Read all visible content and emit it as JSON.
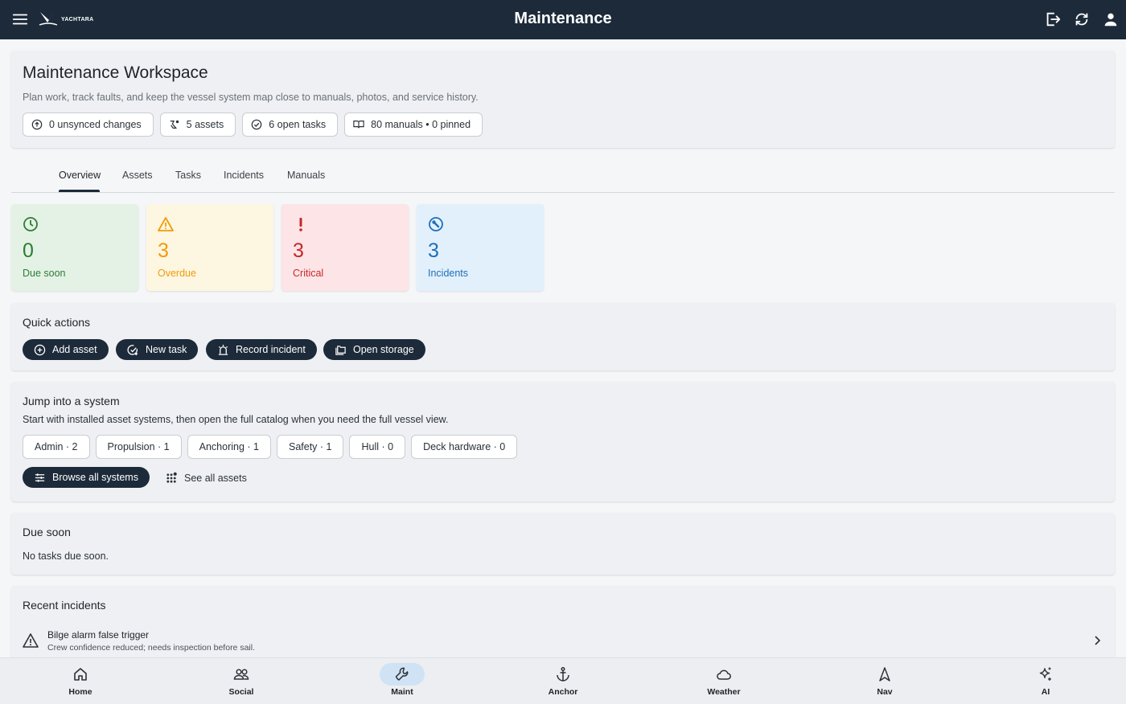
{
  "appbar": {
    "title": "Maintenance",
    "logo_text": "YACHTARA"
  },
  "header": {
    "title": "Maintenance Workspace",
    "subtitle": "Plan work, track faults, and keep the vessel system map close to manuals, photos, and service history.",
    "chips": [
      {
        "icon": "sync-upload-icon",
        "label": "0 unsynced changes"
      },
      {
        "icon": "assets-icon",
        "label": "5 assets"
      },
      {
        "icon": "check-circle-icon",
        "label": "6 open tasks"
      },
      {
        "icon": "book-icon",
        "label": "80 manuals • 0 pinned"
      }
    ]
  },
  "tabs": {
    "items": [
      "Overview",
      "Assets",
      "Tasks",
      "Incidents",
      "Manuals"
    ],
    "active": "Overview"
  },
  "stats": [
    {
      "icon": "clock-icon",
      "value": "0",
      "label": "Due soon",
      "color": "#2e7d32",
      "bg": "#e4f2e6"
    },
    {
      "icon": "warning-icon",
      "value": "3",
      "label": "Overdue",
      "color": "#f29b0a",
      "bg": "#fdf6e1"
    },
    {
      "icon": "exclamation-icon",
      "value": "3",
      "label": "Critical",
      "color": "#c62828",
      "bg": "#fde4e7"
    },
    {
      "icon": "wrench-circle-icon",
      "value": "3",
      "label": "Incidents",
      "color": "#1e6fb8",
      "bg": "#e2f0fb"
    }
  ],
  "quick_actions": {
    "title": "Quick actions",
    "buttons": [
      {
        "icon": "plus-circle-icon",
        "label": "Add asset"
      },
      {
        "icon": "task-add-icon",
        "label": "New task"
      },
      {
        "icon": "alarm-light-icon",
        "label": "Record incident"
      },
      {
        "icon": "folder-copy-icon",
        "label": "Open storage"
      }
    ]
  },
  "systems": {
    "title": "Jump into a system",
    "subtitle": "Start with installed asset systems, then open the full catalog when you need the full vessel view.",
    "chips": [
      "Admin · 2",
      "Propulsion · 1",
      "Anchoring · 1",
      "Safety · 1",
      "Hull · 0",
      "Deck hardware · 0"
    ],
    "browse_label": "Browse all systems",
    "see_all_label": "See all assets"
  },
  "due_soon": {
    "title": "Due soon",
    "empty_text": "No tasks due soon."
  },
  "recent_incidents": {
    "title": "Recent incidents",
    "items": [
      {
        "title": "Bilge alarm false trigger",
        "detail": "Crew confidence reduced; needs inspection before sail."
      }
    ]
  },
  "bottom_nav": {
    "items": [
      {
        "icon": "home-icon",
        "label": "Home"
      },
      {
        "icon": "social-icon",
        "label": "Social"
      },
      {
        "icon": "wrench-icon",
        "label": "Maint"
      },
      {
        "icon": "anchor-icon",
        "label": "Anchor"
      },
      {
        "icon": "cloud-icon",
        "label": "Weather"
      },
      {
        "icon": "navigation-icon",
        "label": "Nav"
      },
      {
        "icon": "sparkle-icon",
        "label": "AI"
      }
    ],
    "active": "Maint"
  }
}
